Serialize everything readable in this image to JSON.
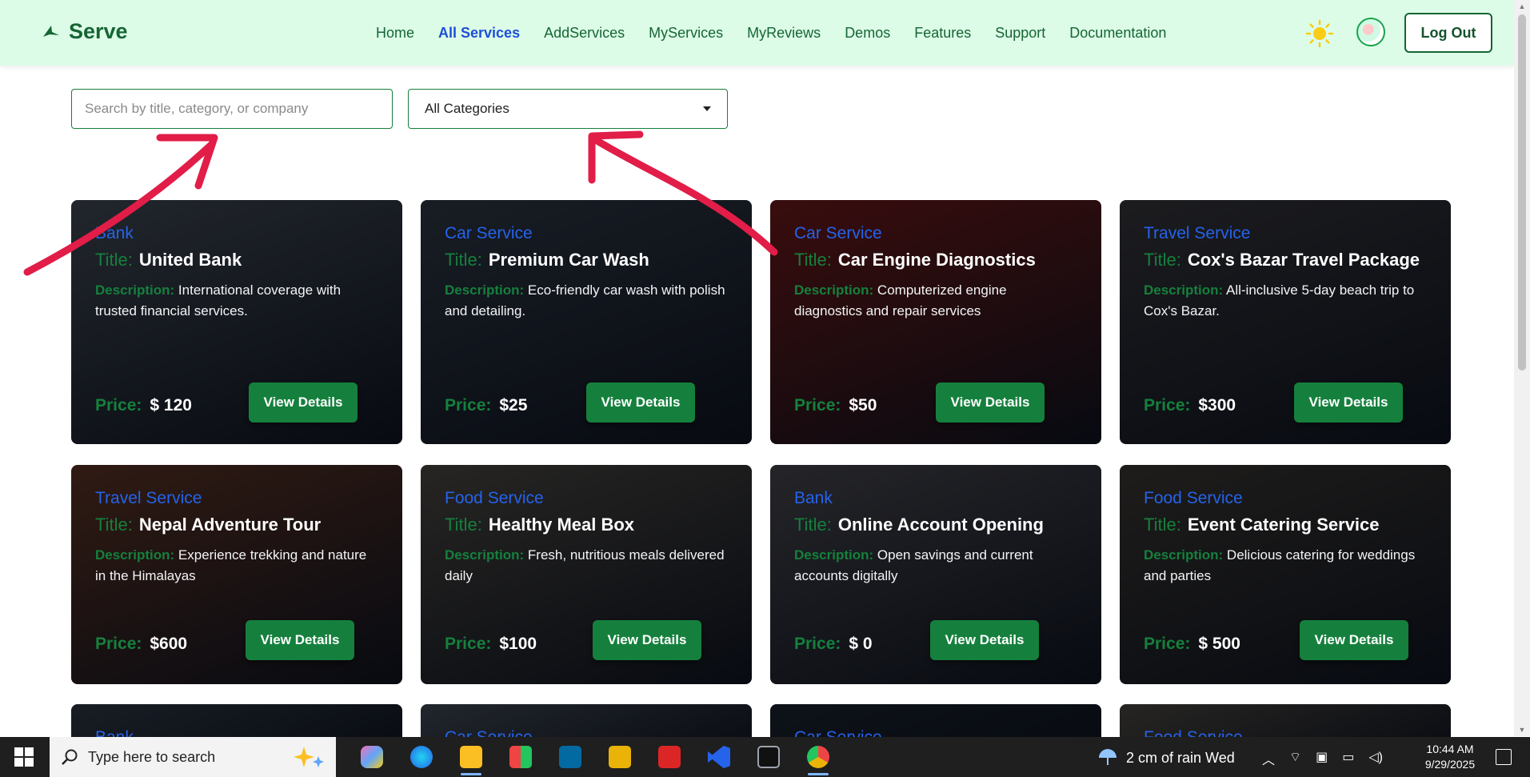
{
  "brand": {
    "name": "Serve"
  },
  "nav": {
    "items": [
      "Home",
      "All Services",
      "AddServices",
      "MyServices",
      "MyReviews",
      "Demos",
      "Features",
      "Support",
      "Documentation"
    ],
    "active": "All Services"
  },
  "header": {
    "logout_label": "Log Out",
    "theme_icon": "sun-icon"
  },
  "filters": {
    "search_placeholder": "Search by title, category, or company",
    "search_value": "",
    "category_selected": "All Categories"
  },
  "labels": {
    "title": "Title:",
    "description": "Description:",
    "price": "Price:",
    "view_details": "View Details"
  },
  "cards": [
    {
      "category": "Bank",
      "title": "United Bank",
      "description": "International coverage with trusted financial services.",
      "price": "$ 120",
      "bg": "#4b5563"
    },
    {
      "category": "Car Service",
      "title": "Premium Car Wash",
      "description": "Eco-friendly car wash with polish and detailing.",
      "price": "$25",
      "bg": "#374151"
    },
    {
      "category": "Car Service",
      "title": "Car Engine Diagnostics",
      "description": "Computerized engine diagnostics and repair services",
      "price": "$50",
      "bg": "#7f1d1d"
    },
    {
      "category": "Travel Service",
      "title": "Cox's Bazar Travel Package",
      "description": "All-inclusive 5-day beach trip to Cox's Bazar.",
      "price": "$300",
      "bg": "#3f3f46"
    },
    {
      "category": "Travel Service",
      "title": "Nepal Adventure Tour",
      "description": "Experience trekking and nature in the Himalayas",
      "price": "$600",
      "bg": "#6b3b2a"
    },
    {
      "category": "Food Service",
      "title": "Healthy Meal Box",
      "description": "Fresh, nutritious meals delivered daily",
      "price": "$100",
      "bg": "#57534e"
    },
    {
      "category": "Bank",
      "title": "Online Account Opening",
      "description": "Open savings and current accounts digitally",
      "price": "$ 0",
      "bg": "#52525b"
    },
    {
      "category": "Food Service",
      "title": "Event Catering Service",
      "description": "Delicious catering for weddings and parties",
      "price": "$ 500",
      "bg": "#44403c"
    },
    {
      "category": "Bank",
      "title": "",
      "description": "",
      "price": "",
      "bg": "#374151"
    },
    {
      "category": "Car Service",
      "title": "",
      "description": "",
      "price": "",
      "bg": "#4b5563"
    },
    {
      "category": "Car Service",
      "title": "",
      "description": "",
      "price": "",
      "bg": "#1f2937"
    },
    {
      "category": "Food Service",
      "title": "",
      "description": "",
      "price": "",
      "bg": "#57534e"
    }
  ],
  "taskbar": {
    "search_placeholder": "Type here to search",
    "weather": "2 cm of rain Wed",
    "time": "10:44 AM",
    "date": "9/29/2025",
    "apps": [
      "copilot-icon",
      "edge-icon",
      "file-explorer-icon",
      "store-icon",
      "outlook-icon",
      "power-bi-icon",
      "wps-icon",
      "vscode-icon",
      "terminal-icon",
      "chrome-icon"
    ]
  }
}
